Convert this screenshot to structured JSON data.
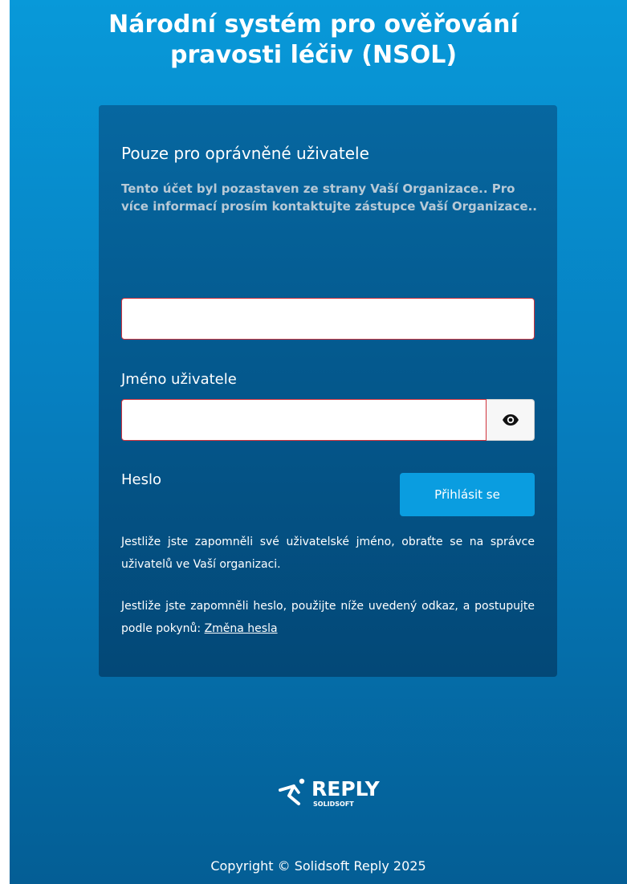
{
  "header": {
    "title": "Národní systém pro ověřování\npravosti léčiv (NSOL)"
  },
  "login": {
    "heading": "Pouze pro oprávněné uživatele",
    "notice": "Tento účet byl pozastaven ze strany Vaší Organizace.. Pro více informací prosím kontaktujte zástupce Vaší Organizace..",
    "username_label": "Jméno uživatele",
    "username_value": "",
    "password_label": "Heslo",
    "password_value": "",
    "show_password_icon": "eye-icon",
    "submit_label": "Přihlásit se",
    "forgot_username_text": "Jestliže jste zapomněli své uživatelské jméno, obraťte se na správce uživatelů ve Vaší organizaci.",
    "forgot_password_text": "Jestliže jste zapomněli heslo, použijte níže uvedený odkaz, a postupujte podle pokynů: ",
    "change_password_link": "Změna hesla"
  },
  "footer": {
    "logo_word": "REPLY",
    "logo_sub": "SOLIDSOFT",
    "copyright": "Copyright © Solidsoft Reply 2025"
  },
  "colors": {
    "background_top": "#0899d9",
    "background_bottom": "#045e95",
    "card": "#04568a",
    "button": "#0a9de0",
    "error_border": "#d1323c",
    "notice_text": "#b7c9d6"
  }
}
